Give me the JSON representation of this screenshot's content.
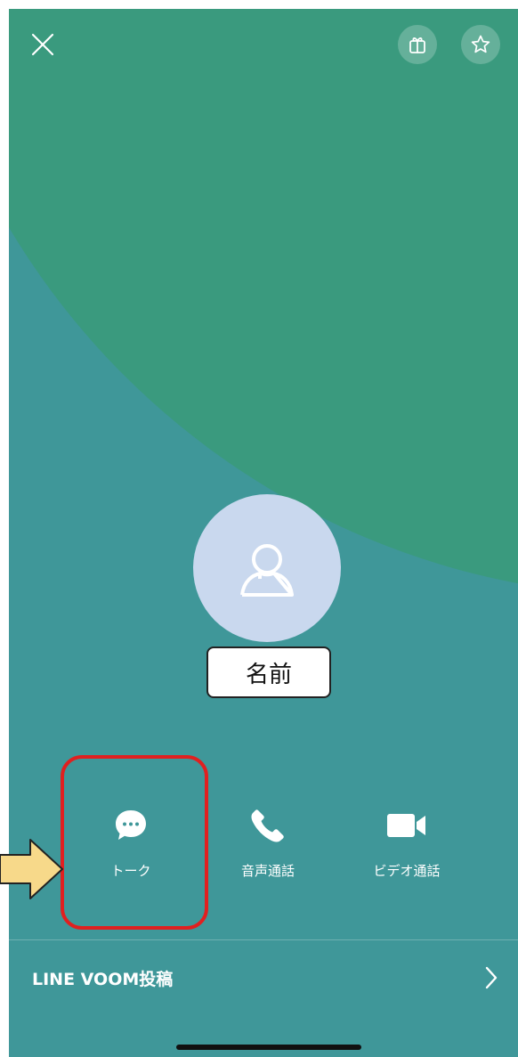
{
  "profile": {
    "name": "名前"
  },
  "actions": [
    {
      "label": "トーク",
      "icon": "chat-bubble-icon"
    },
    {
      "label": "音声通話",
      "icon": "phone-icon"
    },
    {
      "label": "ビデオ通話",
      "icon": "video-camera-icon"
    }
  ],
  "voom": {
    "label": "LINE VOOM投稿",
    "icon": "chevron-right-icon"
  },
  "top_bar": {
    "close_icon": "close-icon",
    "gift_icon": "gift-icon",
    "favorite_icon": "star-icon"
  },
  "colors": {
    "background_teal": "#3f9799",
    "background_green": "#3a9a7e",
    "avatar_bg": "#c9d8ee",
    "highlight_border": "#e02020",
    "arrow_fill": "#f7d98a"
  }
}
